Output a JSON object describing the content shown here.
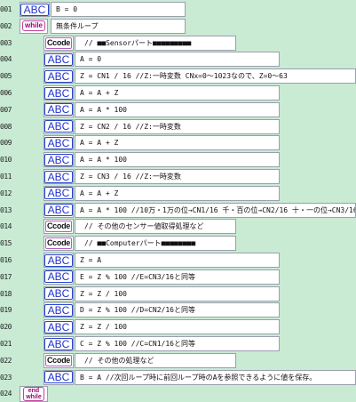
{
  "rows": [
    {
      "num": "001",
      "type": "abc",
      "icon": "ABC",
      "text": "B = 0"
    },
    {
      "num": "002",
      "type": "while",
      "icon": "while",
      "text": "無条件ループ"
    },
    {
      "num": "003",
      "type": "ccode",
      "icon": "Ccode",
      "text": "// ■■Sensorパート■■■■■■■■■"
    },
    {
      "num": "004",
      "type": "abc",
      "icon": "ABC",
      "text": "A = 0"
    },
    {
      "num": "005",
      "type": "abc",
      "icon": "ABC",
      "text": "Z = CN1 / 16  //Z:一時変数  CNx=0～1023なので、Z=0～63"
    },
    {
      "num": "006",
      "type": "abc",
      "icon": "ABC",
      "text": "A = A + Z"
    },
    {
      "num": "007",
      "type": "abc",
      "icon": "ABC",
      "text": "A = A * 100"
    },
    {
      "num": "008",
      "type": "abc",
      "icon": "ABC",
      "text": "Z = CN2 / 16  //Z:一時変数"
    },
    {
      "num": "009",
      "type": "abc",
      "icon": "ABC",
      "text": "A = A + Z"
    },
    {
      "num": "010",
      "type": "abc",
      "icon": "ABC",
      "text": "A = A * 100"
    },
    {
      "num": "011",
      "type": "abc",
      "icon": "ABC",
      "text": "Z = CN3 / 16  //Z:一時変数"
    },
    {
      "num": "012",
      "type": "abc",
      "icon": "ABC",
      "text": "A = A + Z"
    },
    {
      "num": "013",
      "type": "abc",
      "icon": "ABC",
      "text": "A = A * 100  //10万・1万の位→CN1/16  千・百の位→CN2/16  十・一の位→CN3/16"
    },
    {
      "num": "014",
      "type": "ccode",
      "icon": "Ccode",
      "text": "// その他のセンサー値取得処理など"
    },
    {
      "num": "015",
      "type": "ccode",
      "icon": "Ccode",
      "text": "// ■■Computerパート■■■■■■■■"
    },
    {
      "num": "016",
      "type": "abc",
      "icon": "ABC",
      "text": "Z = A"
    },
    {
      "num": "017",
      "type": "abc",
      "icon": "ABC",
      "text": "E = Z % 100  //E=CN3/16と同等"
    },
    {
      "num": "018",
      "type": "abc",
      "icon": "ABC",
      "text": "Z = Z / 100"
    },
    {
      "num": "019",
      "type": "abc",
      "icon": "ABC",
      "text": "D = Z % 100  //D=CN2/16と同等"
    },
    {
      "num": "020",
      "type": "abc",
      "icon": "ABC",
      "text": "Z = Z / 100"
    },
    {
      "num": "021",
      "type": "abc",
      "icon": "ABC",
      "text": "C = Z % 100  //C=CN1/16と同等"
    },
    {
      "num": "022",
      "type": "ccode",
      "icon": "Ccode",
      "text": "// その他の処理など"
    },
    {
      "num": "023",
      "type": "abc",
      "icon": "ABC",
      "text": "B = A  //次回ループ時に前回ループ時のAを参照できるように値を保存。"
    },
    {
      "num": "024",
      "type": "endwhile",
      "icon": "end while",
      "text": ""
    }
  ]
}
